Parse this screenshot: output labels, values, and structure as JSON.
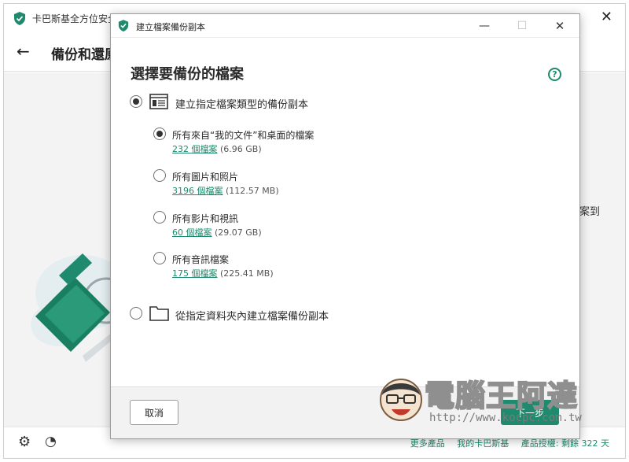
{
  "main_window": {
    "title": "卡巴斯基全方位安全軟體",
    "header_title": "備份和還原",
    "side_text": "案到",
    "footer_links": [
      "更多產品",
      "我的卡巴斯基",
      "產品授權: 剩餘 322 天"
    ]
  },
  "dialog": {
    "title": "建立檔案備份副本",
    "heading": "選擇要備份的檔案",
    "options": [
      {
        "label": "建立指定檔案類型的備份副本",
        "selected": true,
        "sub_options": [
          {
            "label": "所有來自“我的文件”和桌面的檔案",
            "count": "232 個檔案",
            "size": "(6.96 GB)",
            "selected": true
          },
          {
            "label": "所有圖片和照片",
            "count": "3196 個檔案",
            "size": "(112.57 MB)",
            "selected": false
          },
          {
            "label": "所有影片和視訊",
            "count": "60 個檔案",
            "size": "(29.07 GB)",
            "selected": false
          },
          {
            "label": "所有音訊檔案",
            "count": "175 個檔案",
            "size": "(225.41 MB)",
            "selected": false
          }
        ]
      },
      {
        "label": "從指定資料夾內建立檔案備份副本",
        "selected": false
      }
    ],
    "cancel_label": "取消",
    "next_label": "下一步"
  },
  "watermark": {
    "text": "電腦王阿達",
    "url": "http://www.kocpc.com.tw"
  },
  "colors": {
    "accent": "#1f8a6d",
    "footer_bg": "#f2f2f2",
    "content_bg": "#f3f3f3"
  }
}
